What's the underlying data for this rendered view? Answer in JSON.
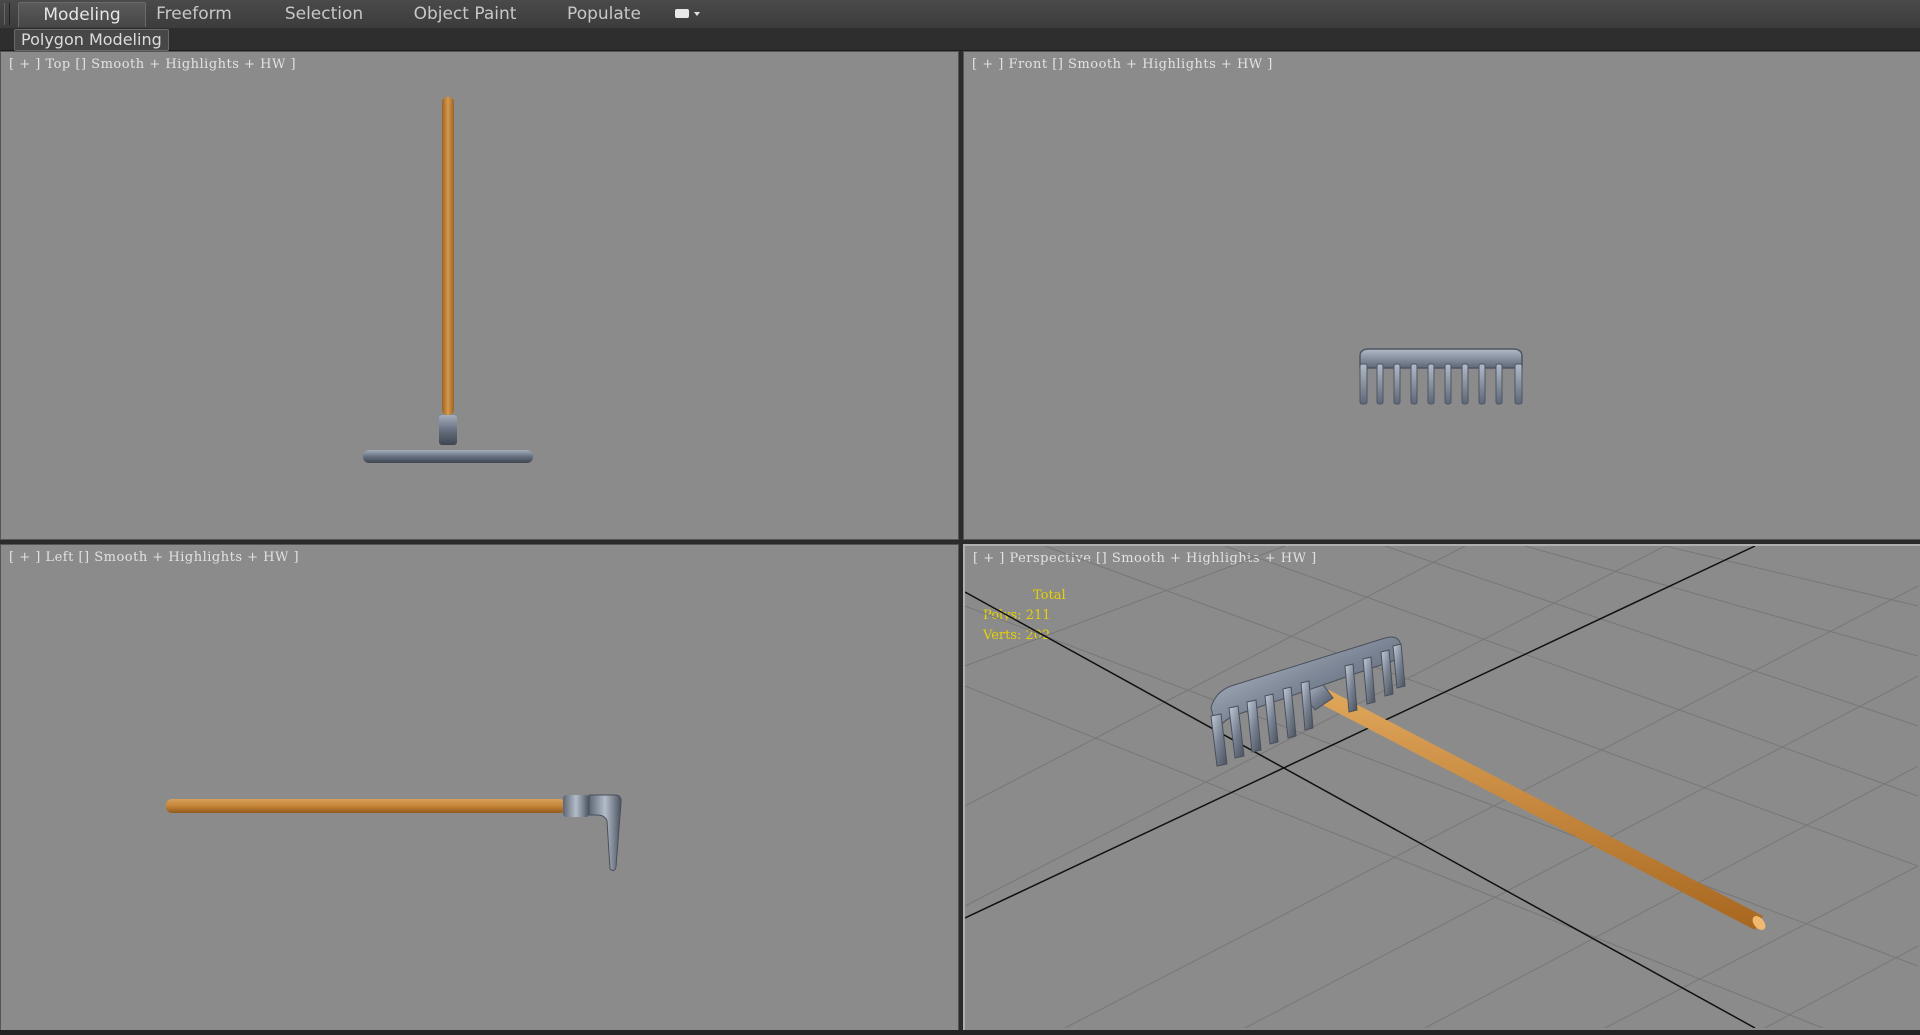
{
  "ribbon": {
    "tabs": [
      {
        "label": "Modeling",
        "active": true
      },
      {
        "label": "Freeform"
      },
      {
        "label": "Selection"
      },
      {
        "label": "Object Paint"
      },
      {
        "label": "Populate"
      }
    ],
    "panel_label": "Polygon Modeling"
  },
  "viewports": {
    "top": {
      "view": "Top",
      "shading": "Smooth",
      "highlights": "Highlights",
      "hw": "HW"
    },
    "front": {
      "view": "Front",
      "shading": "Smooth",
      "highlights": "Highlights",
      "hw": "HW"
    },
    "left": {
      "view": "Left",
      "shading": "Smooth",
      "highlights": "Highlights",
      "hw": "HW"
    },
    "perspective": {
      "view": "Perspective",
      "shading": "Smooth",
      "highlights": "Highlights",
      "hw": "HW"
    }
  },
  "stats": {
    "total_label": "Total",
    "polys": "Polys: 211",
    "verts": "Verts: 202"
  },
  "colors": {
    "viewport_bg": "#8b8b8b",
    "handle_wood": "#c98a3e",
    "metal": "#6f7a8a",
    "stats_text": "#e6d200"
  },
  "icons": [
    "ribbon-options-icon",
    "rake-model"
  ]
}
